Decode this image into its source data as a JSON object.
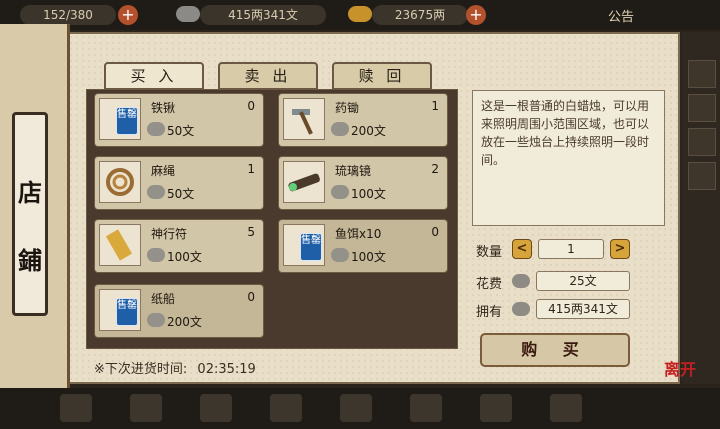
{
  "header": {
    "capacity": "152/380",
    "silver": "415两341文",
    "gold": "23675两",
    "notice": "公告",
    "add_label": "+"
  },
  "shop": {
    "title_top": "店",
    "title_bottom": "鋪"
  },
  "tabs": [
    {
      "label": "买 入",
      "active": true
    },
    {
      "label": "卖 出",
      "active": false
    },
    {
      "label": "赎 回",
      "active": false
    }
  ],
  "items": [
    {
      "name": "铁锹",
      "qty": "0",
      "price": "50文",
      "badge": "售罄",
      "icon": "shovel-icon"
    },
    {
      "name": "药锄",
      "qty": "1",
      "price": "200文",
      "badge": "",
      "icon": "hoe-icon"
    },
    {
      "name": "麻绳",
      "qty": "1",
      "price": "50文",
      "badge": "",
      "icon": "rope-icon"
    },
    {
      "name": "琉璃镜",
      "qty": "2",
      "price": "100文",
      "badge": "",
      "icon": "spyglass-icon"
    },
    {
      "name": "神行符",
      "qty": "5",
      "price": "100文",
      "badge": "",
      "icon": "talisman-icon"
    },
    {
      "name": "鱼饵x10",
      "qty": "0",
      "price": "100文",
      "badge": "售罄",
      "icon": "bait-icon"
    },
    {
      "name": "纸船",
      "qty": "0",
      "price": "200文",
      "badge": "售罄",
      "icon": "paper-boat-icon"
    }
  ],
  "restock": {
    "label": "※下次进货时间:",
    "time": "02:35:19"
  },
  "detail": {
    "description": "这是一根普通的白蜡烛，可以用来照明周围小范围区域，也可以放在一些烛台上持续照明一段时间。",
    "quantity_label": "数量",
    "quantity": "1",
    "cost_label": "花费",
    "cost": "25文",
    "own_label": "拥有",
    "own": "415两341文",
    "buy_label": "购 买",
    "dec": "<",
    "inc": ">"
  },
  "leave_label": "离开",
  "colors": {
    "paper": "#e9dfc8",
    "badge": "#1f5fa8",
    "accent": "#d6a43a"
  }
}
